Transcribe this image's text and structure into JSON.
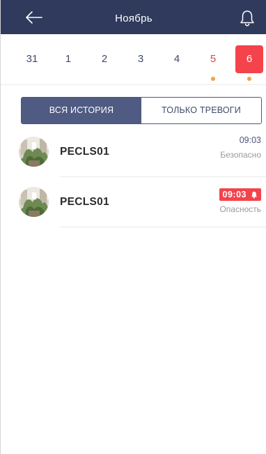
{
  "header": {
    "title": "Ноябрь",
    "back_icon": "arrow-left-icon",
    "bell_icon": "bell-icon",
    "background": "#2f3a5c"
  },
  "dates": [
    {
      "label": "31",
      "red": false,
      "active": false,
      "dot": false
    },
    {
      "label": "1",
      "red": false,
      "active": false,
      "dot": false
    },
    {
      "label": "2",
      "red": false,
      "active": false,
      "dot": false
    },
    {
      "label": "3",
      "red": false,
      "active": false,
      "dot": false
    },
    {
      "label": "4",
      "red": false,
      "active": false,
      "dot": false
    },
    {
      "label": "5",
      "red": true,
      "active": false,
      "dot": true
    },
    {
      "label": "6",
      "red": false,
      "active": true,
      "dot": true
    }
  ],
  "segment": {
    "all_history": "ВСЯ ИСТОРИЯ",
    "alarms_only": "ТОЛЬКО ТРЕВОГИ",
    "selected": "all_history"
  },
  "events": [
    {
      "device": "PECLS01",
      "time": "09:03",
      "status": "Безопасно",
      "alarm": false
    },
    {
      "device": "PECLS01",
      "time": "09:03",
      "status": "Опасность",
      "alarm": true
    }
  ],
  "colors": {
    "accent_red": "#f4434b",
    "dot_orange": "#f5a040",
    "navy": "#2f3a5c",
    "segment_active": "#4f5b82"
  }
}
